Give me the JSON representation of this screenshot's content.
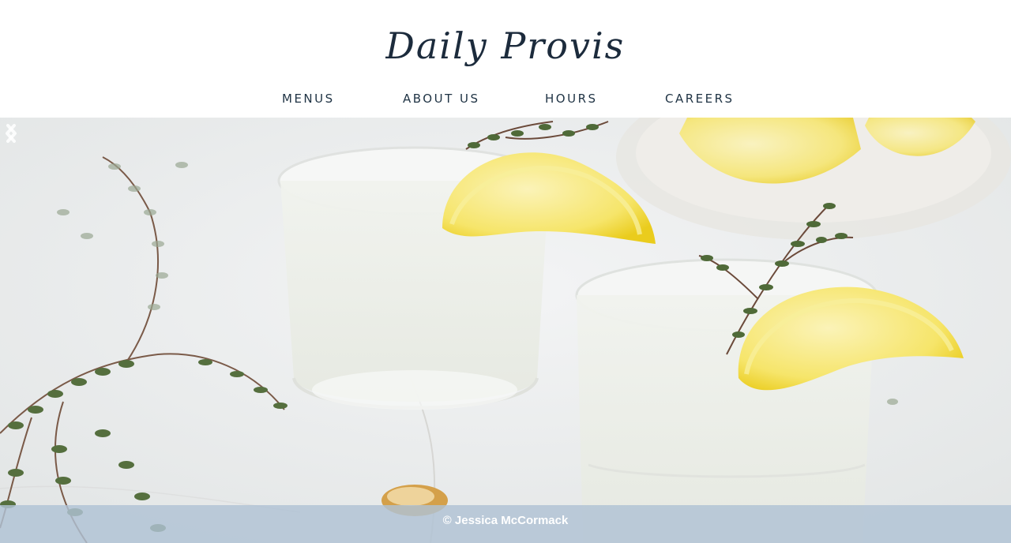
{
  "brand": {
    "name": "Daily Provisions"
  },
  "nav": {
    "items": [
      {
        "label": "MENUS"
      },
      {
        "label": "ABOUT US"
      },
      {
        "label": "HOURS"
      },
      {
        "label": "CAREERS"
      }
    ]
  },
  "hero": {
    "image": "lemonade-glasses-with-lemon-and-thyme",
    "prev_icon": "chevron-left-icon",
    "next_icon": "chevron-right-icon"
  },
  "footer": {
    "credit": "© Jessica McCormack",
    "bar_color": "#b0c2d4"
  },
  "colors": {
    "nav_text": "#1f3344",
    "logo_ink": "#1c2b3c"
  }
}
